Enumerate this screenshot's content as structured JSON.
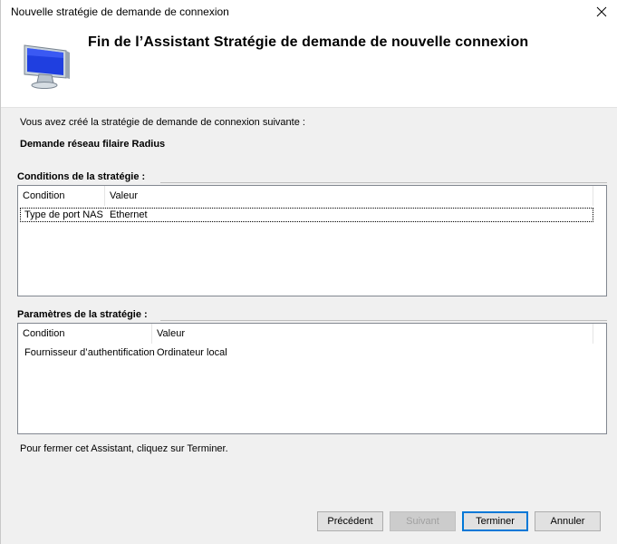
{
  "window": {
    "title": "Nouvelle stratégie de demande de connexion"
  },
  "header": {
    "heading": "Fin de l’Assistant Stratégie de demande de nouvelle connexion",
    "icon": "computer-monitor-icon"
  },
  "intro_text": "Vous avez créé la stratégie de demande de connexion suivante :",
  "policy_name": "Demande réseau filaire Radius",
  "conditions": {
    "label": "Conditions de la stratégie :",
    "columns": [
      "Condition",
      "Valeur"
    ],
    "rows": [
      {
        "condition": "Type de port NAS",
        "value": "Ethernet"
      }
    ]
  },
  "settings": {
    "label": "Paramètres de la stratégie :",
    "columns": [
      "Condition",
      "Valeur"
    ],
    "rows": [
      {
        "condition": "Fournisseur d’authentification",
        "value": "Ordinateur local"
      }
    ]
  },
  "footer_text": "Pour fermer cet Assistant, cliquez sur Terminer.",
  "buttons": {
    "previous": "Précédent",
    "next": "Suivant",
    "finish": "Terminer",
    "cancel": "Annuler"
  },
  "colors": {
    "accent": "#0078d7",
    "window_bg": "#f0f0f0"
  }
}
